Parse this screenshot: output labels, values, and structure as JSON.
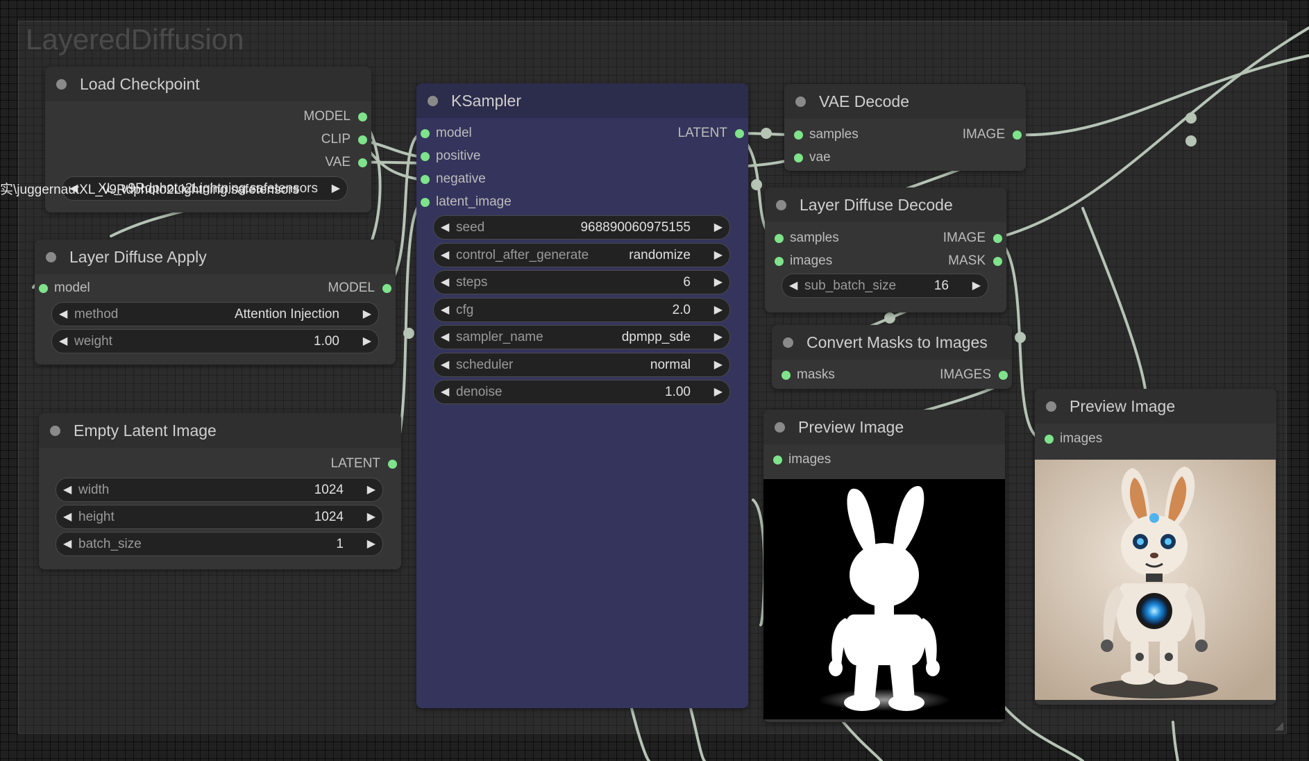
{
  "group": {
    "title": "LayeredDiffusion"
  },
  "colors": {
    "link": "#b6c4b6",
    "slot": "#7ee38a",
    "ksampler_bg": "#34345c"
  },
  "load_checkpoint": {
    "title": "Load Checkpoint",
    "outputs": [
      "MODEL",
      "CLIP",
      "VAE"
    ],
    "ckpt_name": "实\\juggernautXL_v9Rdphoto2Lightning.safetensors",
    "ckpt_shown": "XL_v9Rdphoto2Lightning.safetensors"
  },
  "layer_diffuse_apply": {
    "title": "Layer Diffuse Apply",
    "input": "model",
    "output": "MODEL",
    "widgets": [
      {
        "name": "method",
        "value": "Attention Injection"
      },
      {
        "name": "weight",
        "value": "1.00"
      }
    ]
  },
  "empty_latent": {
    "title": "Empty Latent Image",
    "output": "LATENT",
    "widgets": [
      {
        "name": "width",
        "value": "1024"
      },
      {
        "name": "height",
        "value": "1024"
      },
      {
        "name": "batch_size",
        "value": "1"
      }
    ]
  },
  "ksampler": {
    "title": "KSampler",
    "inputs": [
      "model",
      "positive",
      "negative",
      "latent_image"
    ],
    "output": "LATENT",
    "widgets": [
      {
        "name": "seed",
        "value": "968890060975155"
      },
      {
        "name": "control_after_generate",
        "value": "randomize"
      },
      {
        "name": "steps",
        "value": "6"
      },
      {
        "name": "cfg",
        "value": "2.0"
      },
      {
        "name": "sampler_name",
        "value": "dpmpp_sde"
      },
      {
        "name": "scheduler",
        "value": "normal"
      },
      {
        "name": "denoise",
        "value": "1.00"
      }
    ]
  },
  "vae_decode": {
    "title": "VAE Decode",
    "inputs": [
      "samples",
      "vae"
    ],
    "output": "IMAGE"
  },
  "layer_diffuse_decode": {
    "title": "Layer Diffuse Decode",
    "inputs": [
      "samples",
      "images"
    ],
    "outputs": [
      "IMAGE",
      "MASK"
    ],
    "widgets": [
      {
        "name": "sub_batch_size",
        "value": "16"
      }
    ]
  },
  "convert_masks": {
    "title": "Convert Masks to Images",
    "input": "masks",
    "output": "IMAGES"
  },
  "preview_mask": {
    "title": "Preview Image",
    "input": "images"
  },
  "preview_rgb": {
    "title": "Preview Image",
    "input": "images"
  }
}
